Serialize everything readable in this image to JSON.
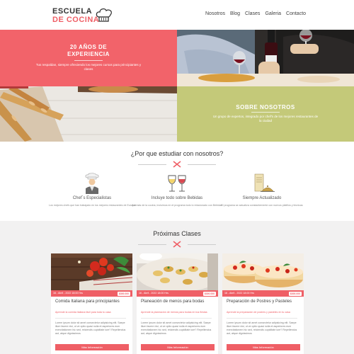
{
  "header": {
    "logo_line1": "ESCUELA",
    "logo_line2": "DE COCINA",
    "nav": [
      "Nosotros",
      "Blog",
      "Clases",
      "Galeria",
      "Contacto"
    ]
  },
  "hero": {
    "experience": {
      "title_line1": "20 AÑOS DE",
      "title_line2": "EXPERIENCIA",
      "text": "Tus respaldan, siempre ofreciendo los mejores cursos para principiantes y clases"
    },
    "about": {
      "title": "SOBRE NOSOTROS",
      "text": "Un grupo de expertos, integrado por chef's de los mejores restaurantes de la ciudad"
    }
  },
  "why": {
    "title": "¿Por que estudiar con nosotros?",
    "features": [
      {
        "icon": "chef-icon",
        "title": "Chef´s Especialistas",
        "text": "Los mejores chefs que han trabajado en los mejores restaurantes de Europa"
      },
      {
        "icon": "wine-glasses-icon",
        "title": "Incluye todo sobre Bebidas",
        "text": "Además de la cocina, incluimos en el programa todo lo relacionado con Bebidas"
      },
      {
        "icon": "recipe-book-icon",
        "title": "Siempre Actualizado",
        "text": "El programa se actualiza constantemente con nuevos platillos y técnicas"
      }
    ]
  },
  "upcoming": {
    "title": "Próximas Clases",
    "cards": [
      {
        "date": "16 - Abril - 2022 18:00 Hrs",
        "price": "$300.000",
        "title": "Comida Italiana para principiantes",
        "subtitle": "Aprende la comida italiana fácil para toda tu casa",
        "body": "Lorem ipsum dolor sit amet consectetur adipisicing elit. Saepe illum facere nisi, ut ve optio quasi nulla et asperiores eum exercitationem hic sed, reiciendis cupiditate iure? Repellendus aut, atque dignissimos",
        "button": "Más Información"
      },
      {
        "date": "16 - Abril - 2022 18:00 Hrs",
        "price": "$300.000",
        "title": "Planeación de menús para bodas",
        "subtitle": "Aprende la planeación de menús para bodas en tus fiestas",
        "body": "Lorem ipsum dolor sit amet consectetur adipisicing elit. Saepe illum facere nisi, ut ve optio quasi nulla et asperiores eum exercitationem hic sed, reiciendis cupiditate iure? Repellendus aut, atque dignissimos",
        "button": "Más Información"
      },
      {
        "date": "16 - Abril - 2022 18:00 Hrs",
        "price": "$300.000",
        "title": "Preparación de Postres y Pasteles",
        "subtitle": "Aprende la preparación de postres y pasteles en tu casa",
        "body": "Lorem ipsum dolor sit amet consectetur adipisicing elit. Saepe illum facere nisi, ut ve optio quasi nulla et asperiores eum exercitationem hic sed, reiciendis cupiditate iure? Repellendus aut, atque dignissimos",
        "button": "Más Información"
      }
    ]
  },
  "colors": {
    "accent": "#ef5f66",
    "olive": "#c4c979",
    "bg_gray": "#f2f1f1"
  }
}
